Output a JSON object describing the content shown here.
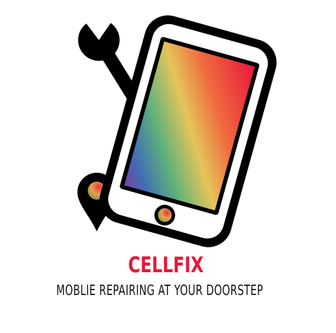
{
  "logo": {
    "brand_name": "CELLFIX",
    "tagline": "MOBLIE REPAIRING AT YOUR DOORSTEP",
    "colors": {
      "brand": "#e8173a",
      "ink": "#111111"
    },
    "icons": [
      "wrench-icon",
      "smartphone-icon",
      "location-pin-icon"
    ]
  }
}
